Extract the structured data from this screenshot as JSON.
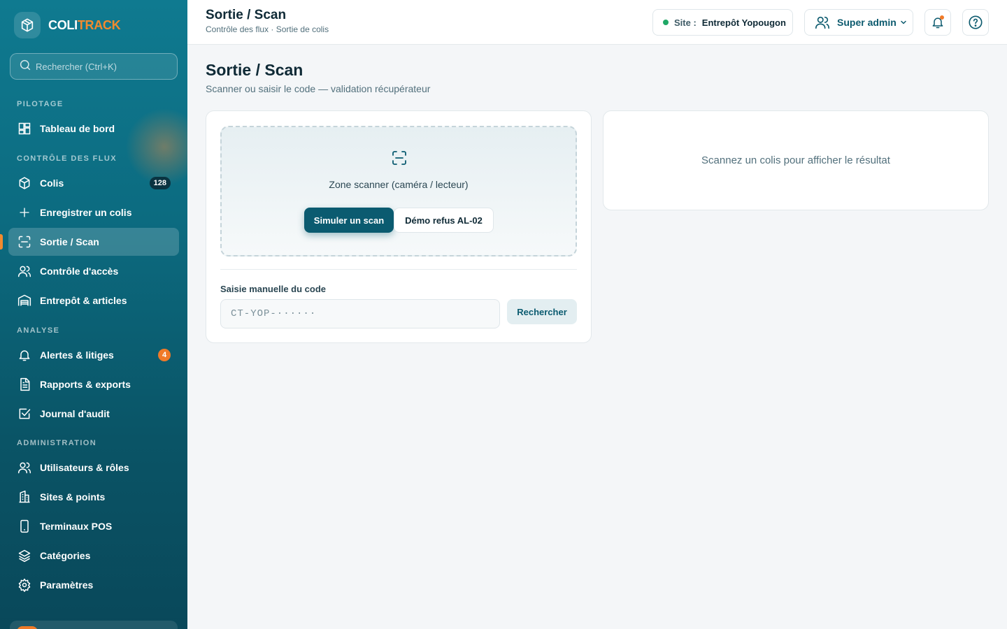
{
  "brand": {
    "name_part1": "COLI",
    "name_part2": "TRACK"
  },
  "search": {
    "placeholder": "Rechercher (Ctrl+K)"
  },
  "sidebar": {
    "sections": {
      "pilotage": "PILOTAGE",
      "flux": "CONTRÔLE DES FLUX",
      "analyse": "ANALYSE",
      "admin": "ADMINISTRATION"
    },
    "items": {
      "dashboard": "Tableau de bord",
      "colis": "Colis",
      "colis_badge": "128",
      "register": "Enregistrer un colis",
      "scan": "Sortie / Scan",
      "access": "Contrôle d'accès",
      "warehouse": "Entrepôt & articles",
      "alerts": "Alertes & litiges",
      "alerts_badge": "4",
      "reports": "Rapports & exports",
      "audit": "Journal d'audit",
      "users": "Utilisateurs & rôles",
      "sites": "Sites & points",
      "pos": "Terminaux POS",
      "categories": "Catégories",
      "settings": "Paramètres"
    }
  },
  "header": {
    "title": "Sortie / Scan",
    "breadcrumb": "Contrôle des flux · Sortie de colis",
    "site_label": "Site :",
    "site_value": "Entrepôt Yopougon",
    "user_role": "Super admin"
  },
  "main": {
    "title": "Sortie / Scan",
    "subtitle": "Scanner ou saisir le code — validation récupérateur",
    "scanner": {
      "zone_label": "Zone scanner (caméra / lecteur)",
      "simulate_button": "Simuler un scan",
      "demo_button": "Démo refus AL-02"
    },
    "manual": {
      "label": "Saisie manuelle du code",
      "placeholder": "CT-YOP-······",
      "search_button": "Rechercher"
    },
    "result": {
      "empty_text": "Scannez un colis pour afficher le résultat"
    }
  },
  "colors": {
    "sidebar_top": "#0f7a90",
    "sidebar_bottom": "#09485a",
    "accent": "#f28a2e",
    "primary": "#0b5b70",
    "status_online": "#1fa866"
  }
}
